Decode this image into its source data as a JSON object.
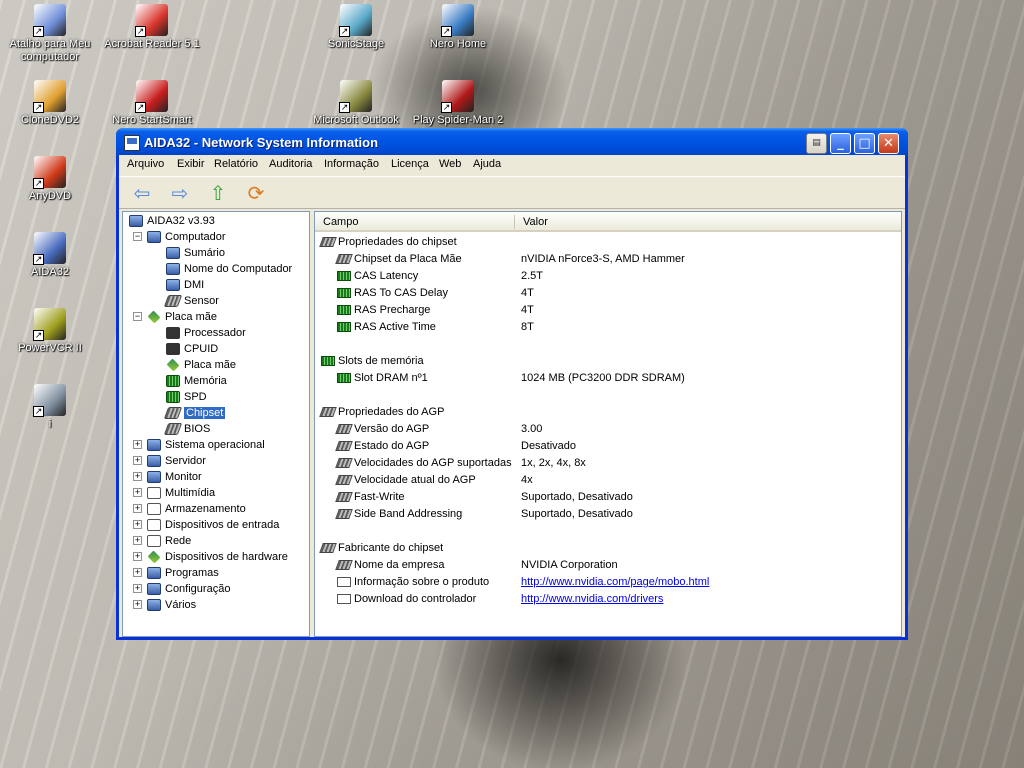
{
  "desktop": {
    "icons": [
      {
        "label": "Atalho para Meu computador",
        "icon": "my-computer-icon",
        "color": "#6f8fd8"
      },
      {
        "label": "Acrobat Reader 5.1",
        "icon": "acrobat-icon",
        "color": "#d9342b"
      },
      {
        "label": "SonicStage",
        "icon": "sonicstage-icon",
        "color": "#5aa9c9"
      },
      {
        "label": "Nero Home",
        "icon": "nero-home-icon",
        "color": "#3a7cc4"
      },
      {
        "label": "CloneDVD2",
        "icon": "clonedvd-icon",
        "color": "#e0a030"
      },
      {
        "label": "Nero StartSmart",
        "icon": "nero-startsmart-icon",
        "color": "#c91e1e"
      },
      {
        "label": "Microsoft Outlook",
        "icon": "outlook-icon",
        "color": "#8a8a40"
      },
      {
        "label": "Play Spider-Man 2",
        "icon": "spiderman-icon",
        "color": "#b01818"
      },
      {
        "label": "AnyDVD",
        "icon": "anydvd-icon",
        "color": "#d03a1a"
      },
      {
        "label": "AIDA32",
        "icon": "aida32-icon",
        "color": "#4a6cc0"
      },
      {
        "label": "PowerVCR II",
        "icon": "powervcr-icon",
        "color": "#a0a020"
      },
      {
        "label": "i",
        "icon": "generic-app-icon",
        "color": "#8090a0"
      }
    ]
  },
  "window": {
    "title": "AIDA32 - Network System Information",
    "buttons": {
      "extra": "▤",
      "minimize": "_",
      "maximize": "□",
      "close": "✕"
    },
    "accent": "#0054e3"
  },
  "menu": [
    "Arquivo",
    "Exibir",
    "Relatório",
    "Auditoria",
    "Informação",
    "Licença",
    "Web",
    "Ajuda"
  ],
  "toolbar": [
    {
      "name": "back-icon",
      "glyph": "⇦",
      "color": "#5a8ad8"
    },
    {
      "name": "forward-icon",
      "glyph": "⇨",
      "color": "#5a8ad8"
    },
    {
      "name": "up-icon",
      "glyph": "⇧",
      "color": "#3aa83a"
    },
    {
      "name": "refresh-icon",
      "glyph": "⟳",
      "color": "#e07a20"
    }
  ],
  "tree": {
    "root": "AIDA32 v3.93",
    "nodes": [
      {
        "label": "Computador",
        "level": 1,
        "expander": "-",
        "icon": "ic-pc"
      },
      {
        "label": "Sumário",
        "level": 2,
        "icon": "ic-pc"
      },
      {
        "label": "Nome do Computador",
        "level": 2,
        "icon": "ic-pc"
      },
      {
        "label": "DMI",
        "level": 2,
        "icon": "ic-pc"
      },
      {
        "label": "Sensor",
        "level": 2,
        "icon": "ic-chip"
      },
      {
        "label": "Placa mãe",
        "level": 1,
        "expander": "-",
        "icon": "ic-mb"
      },
      {
        "label": "Processador",
        "level": 2,
        "icon": "ic-cpu"
      },
      {
        "label": "CPUID",
        "level": 2,
        "icon": "ic-cpu"
      },
      {
        "label": "Placa mãe",
        "level": 2,
        "icon": "ic-mb"
      },
      {
        "label": "Memória",
        "level": 2,
        "icon": "ic-ram"
      },
      {
        "label": "SPD",
        "level": 2,
        "icon": "ic-ram"
      },
      {
        "label": "Chipset",
        "level": 2,
        "icon": "ic-chip",
        "selected": true
      },
      {
        "label": "BIOS",
        "level": 2,
        "icon": "ic-chip"
      },
      {
        "label": "Sistema operacional",
        "level": 1,
        "expander": "+",
        "icon": "ic-pc"
      },
      {
        "label": "Servidor",
        "level": 1,
        "expander": "+",
        "icon": "ic-pc"
      },
      {
        "label": "Monitor",
        "level": 1,
        "expander": "+",
        "icon": "ic-pc"
      },
      {
        "label": "Multimídia",
        "level": 1,
        "expander": "+",
        "icon": "ic-doc"
      },
      {
        "label": "Armazenamento",
        "level": 1,
        "expander": "+",
        "icon": "ic-doc"
      },
      {
        "label": "Dispositivos de entrada",
        "level": 1,
        "expander": "+",
        "icon": "ic-doc"
      },
      {
        "label": "Rede",
        "level": 1,
        "expander": "+",
        "icon": "ic-doc"
      },
      {
        "label": "Dispositivos de hardware",
        "level": 1,
        "expander": "+",
        "icon": "ic-mb"
      },
      {
        "label": "Programas",
        "level": 1,
        "expander": "+",
        "icon": "ic-pc"
      },
      {
        "label": "Configuração",
        "level": 1,
        "expander": "+",
        "icon": "ic-pc"
      },
      {
        "label": "Vários",
        "level": 1,
        "expander": "+",
        "icon": "ic-pc"
      }
    ]
  },
  "grid": {
    "columns": [
      "Campo",
      "Valor"
    ],
    "sections": [
      {
        "title": "Propriedades do chipset",
        "icon": "ic-chip",
        "rows": [
          {
            "field": "Chipset da Placa Mãe",
            "value": "nVIDIA nForce3-S, AMD Hammer",
            "icon": "ic-chip"
          },
          {
            "field": "CAS Latency",
            "value": "2.5T",
            "icon": "ic-ram"
          },
          {
            "field": "RAS To CAS Delay",
            "value": "4T",
            "icon": "ic-ram"
          },
          {
            "field": "RAS Precharge",
            "value": "4T",
            "icon": "ic-ram"
          },
          {
            "field": "RAS Active Time",
            "value": "8T",
            "icon": "ic-ram"
          }
        ]
      },
      {
        "title": "Slots de memória",
        "icon": "ic-ram",
        "rows": [
          {
            "field": "Slot DRAM nº1",
            "value": "1024 MB  (PC3200 DDR SDRAM)",
            "icon": "ic-ram"
          }
        ]
      },
      {
        "title": "Propriedades do AGP",
        "icon": "ic-chip",
        "rows": [
          {
            "field": "Versão do AGP",
            "value": "3.00",
            "icon": "ic-chip"
          },
          {
            "field": "Estado do AGP",
            "value": "Desativado",
            "icon": "ic-chip"
          },
          {
            "field": "Velocidades do AGP suportadas",
            "value": "1x, 2x, 4x, 8x",
            "icon": "ic-chip"
          },
          {
            "field": "Velocidade atual do AGP",
            "value": "4x",
            "icon": "ic-chip"
          },
          {
            "field": "Fast-Write",
            "value": "Suportado, Desativado",
            "icon": "ic-chip"
          },
          {
            "field": "Side Band Addressing",
            "value": "Suportado, Desativado",
            "icon": "ic-chip"
          }
        ]
      },
      {
        "title": "Fabricante do chipset",
        "icon": "ic-chip",
        "rows": [
          {
            "field": "Nome da empresa",
            "value": "NVIDIA Corporation",
            "icon": "ic-chip"
          },
          {
            "field": "Informação sobre o produto",
            "value": "http://www.nvidia.com/page/mobo.html",
            "icon": "ic-doc",
            "link": true
          },
          {
            "field": "Download do controlador",
            "value": "http://www.nvidia.com/drivers",
            "icon": "ic-doc",
            "link": true
          }
        ]
      }
    ]
  }
}
